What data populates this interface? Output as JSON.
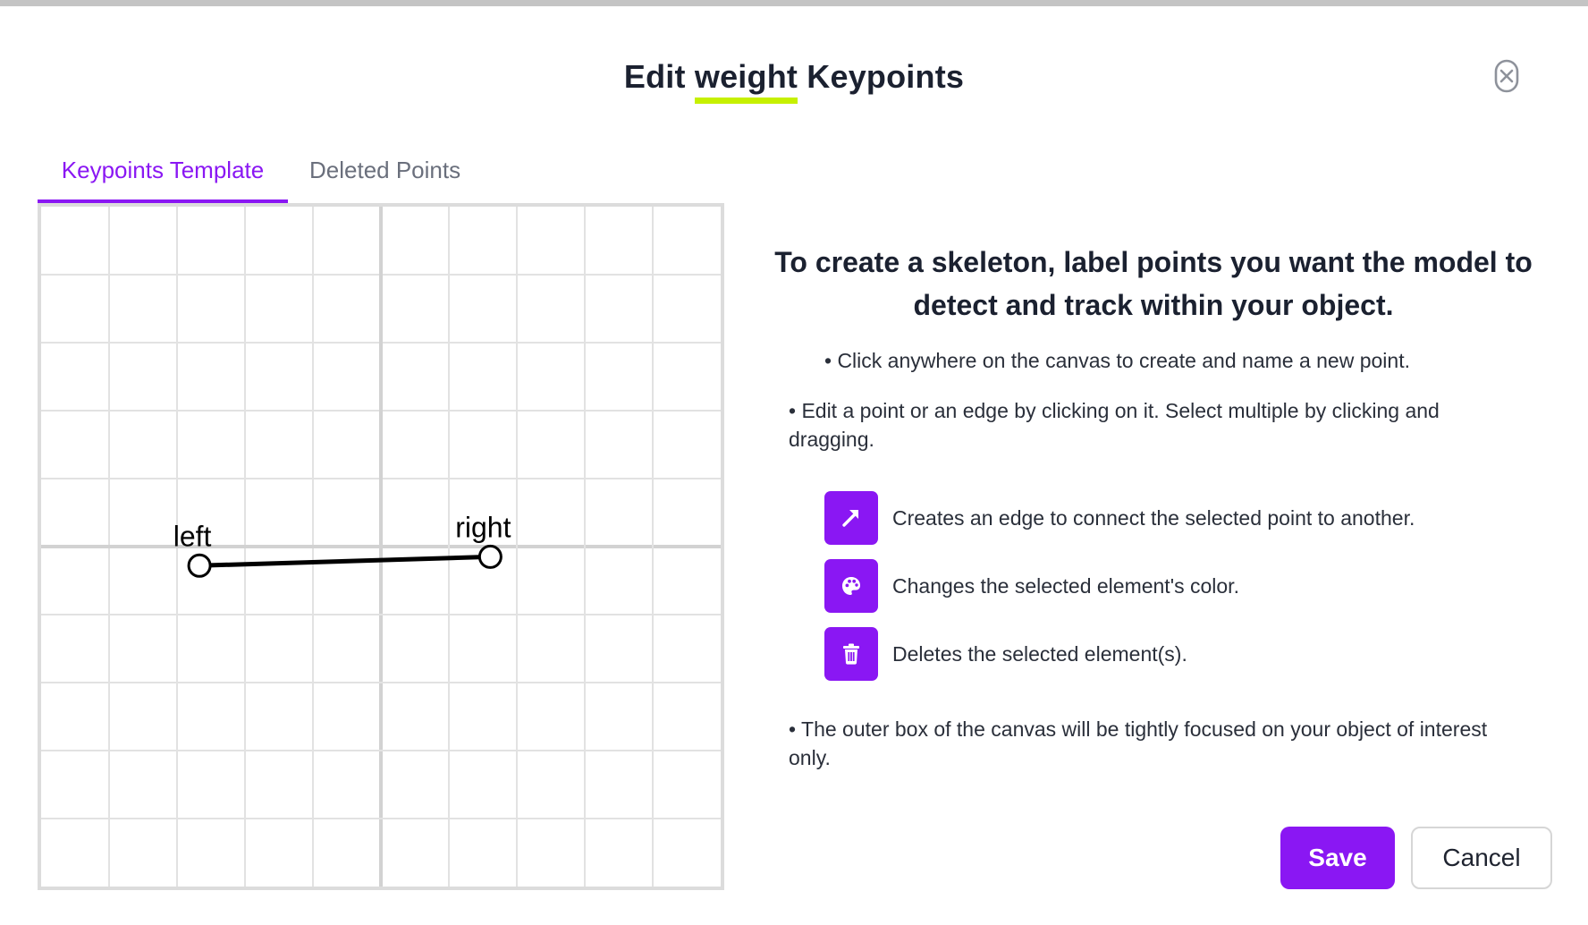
{
  "dialog": {
    "title_prefix": "Edit",
    "title_highlight": "weight",
    "title_suffix": "Keypoints"
  },
  "tabs": [
    {
      "label": "Keypoints Template",
      "active": true
    },
    {
      "label": "Deleted Points",
      "active": false
    }
  ],
  "canvas": {
    "grid_divisions": 10,
    "points": [
      {
        "name": "left",
        "x": 0.233,
        "y": 0.528
      },
      {
        "name": "right",
        "x": 0.661,
        "y": 0.515
      }
    ],
    "edges": [
      {
        "from": "left",
        "to": "right",
        "color": "#000000"
      }
    ]
  },
  "instructions": {
    "headline": "To create a skeleton, label points you want the model to detect and track within your object.",
    "bullet_create": "• Click anywhere on the canvas to create and name a new point.",
    "bullet_edit": "• Edit a point or an edge by clicking on it. Select multiple by clicking and dragging.",
    "tools": [
      {
        "icon": "arrow-icon",
        "label": "Creates an edge to connect the selected point to another."
      },
      {
        "icon": "palette-icon",
        "label": "Changes the selected element's color."
      },
      {
        "icon": "trash-icon",
        "label": "Deletes the selected element(s)."
      }
    ],
    "bullet_box": "• The outer box of the canvas will be tightly focused on your object of interest only."
  },
  "footer": {
    "save_label": "Save",
    "cancel_label": "Cancel"
  },
  "colors": {
    "accent": "#8a17f3",
    "title_underline": "#c6f000",
    "grid_line": "#e2e2e2",
    "grid_major": "#d2d2d2"
  }
}
